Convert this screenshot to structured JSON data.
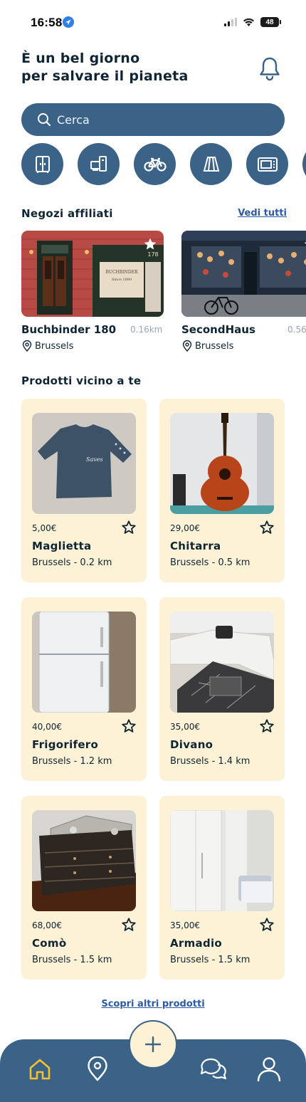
{
  "status": {
    "time": "16:58",
    "battery": "48"
  },
  "header": {
    "line1": "È un bel giorno",
    "line2": "per salvare il pianeta"
  },
  "search": {
    "placeholder": "Cerca"
  },
  "categories": [
    "wardrobe-icon",
    "appliances-icon",
    "bicycle-icon",
    "lamp-icon",
    "microwave-icon"
  ],
  "shops_section": {
    "title": "Negozi affiliati",
    "see_all": "Vedi tutti"
  },
  "shops": [
    {
      "name": "Buchbinder 180",
      "distance": "0.16km",
      "city": "Brussels"
    },
    {
      "name": "SecondHaus",
      "distance": "0.56",
      "city": "Brussels"
    }
  ],
  "products_section": {
    "title": "Prodotti vicino a te"
  },
  "products": [
    {
      "price": "5,00€",
      "name": "Maglietta",
      "location": "Brussels - 0.2 km"
    },
    {
      "price": "29,00€",
      "name": "Chitarra",
      "location": "Brussels - 0.5 km"
    },
    {
      "price": "40,00€",
      "name": "Frigorifero",
      "location": "Brussels - 1.2 km"
    },
    {
      "price": "35,00€",
      "name": "Divano",
      "location": "Brussels - 1.4 km"
    },
    {
      "price": "68,00€",
      "name": "Comò",
      "location": "Brussels - 1.5 km"
    },
    {
      "price": "35,00€",
      "name": "Armadio",
      "location": "Brussels - 1.5 km"
    }
  ],
  "more_link": "Scopri altri prodotti",
  "tabs": [
    "home-icon",
    "map-pin-icon",
    "add-icon",
    "chat-icon",
    "profile-icon"
  ],
  "colors": {
    "primary": "#3b6287",
    "card": "#fdf2d6",
    "active_tab": "#f2c230",
    "text": "#0f2533",
    "link": "#2d5aa0"
  }
}
